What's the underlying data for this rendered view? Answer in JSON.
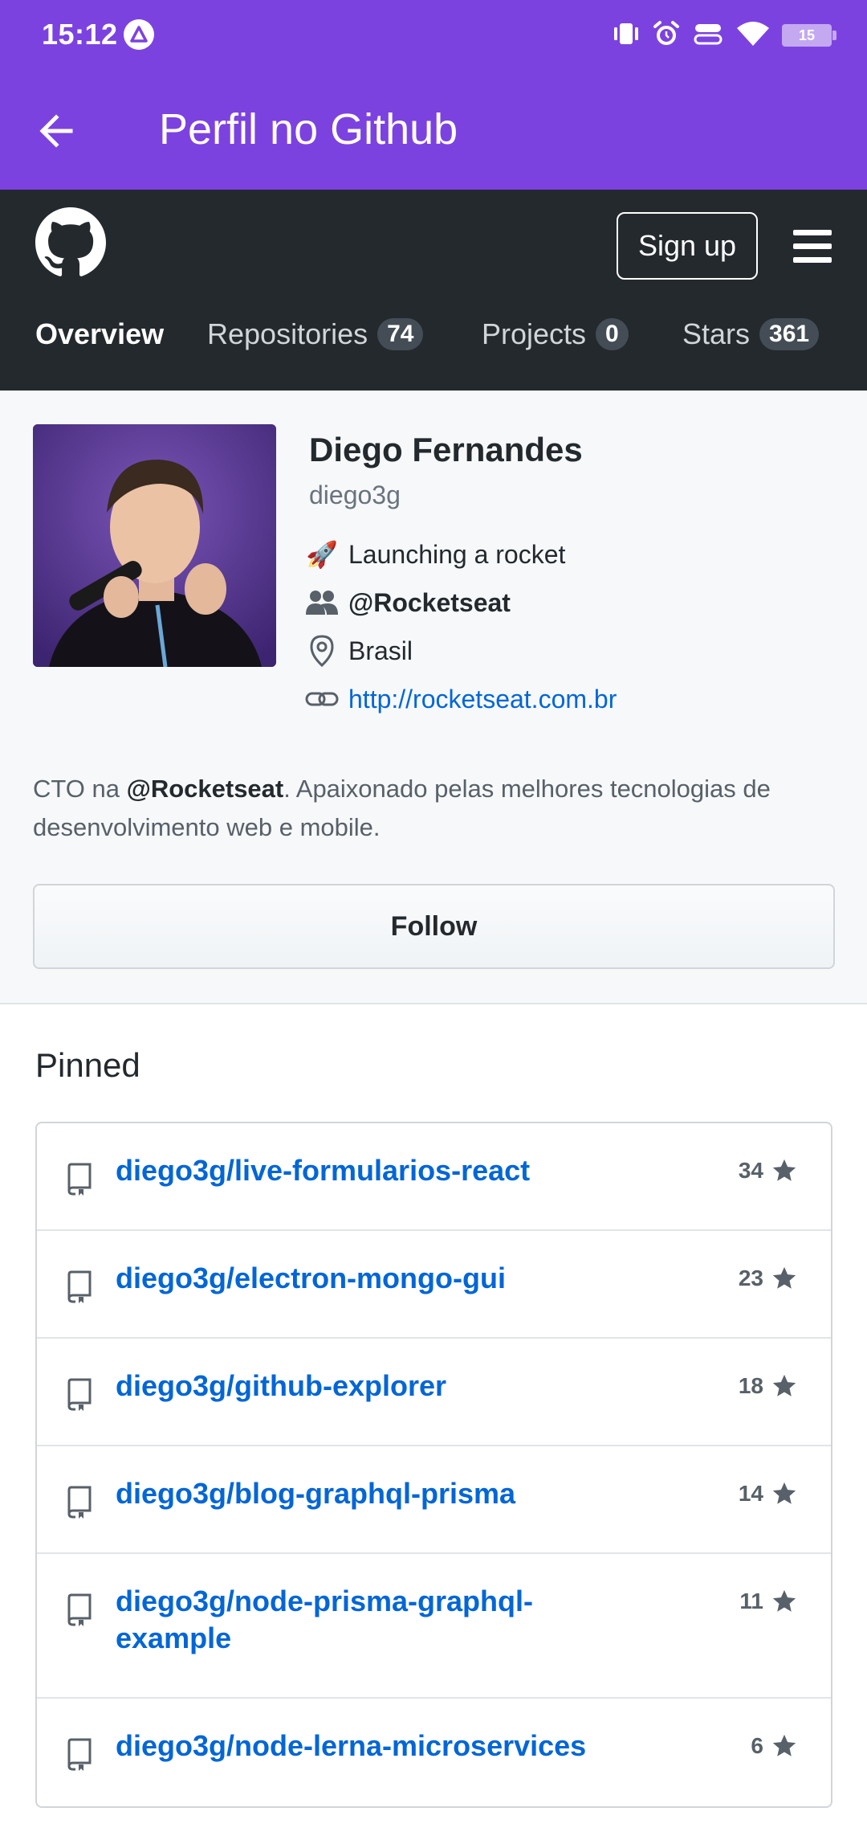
{
  "status_bar": {
    "time": "15:12",
    "battery": "15"
  },
  "app_bar": {
    "title": "Perfil no Github"
  },
  "github_header": {
    "signup_label": "Sign up",
    "tabs": [
      {
        "label": "Overview",
        "count": null
      },
      {
        "label": "Repositories",
        "count": "74"
      },
      {
        "label": "Projects",
        "count": "0"
      },
      {
        "label": "Stars",
        "count": "361"
      }
    ]
  },
  "profile": {
    "name": "Diego Fernandes",
    "login": "diego3g",
    "status": "Launching a rocket",
    "status_emoji": "🚀",
    "organization": "@Rocketseat",
    "location": "Brasil",
    "website": "http://rocketseat.com.br",
    "bio_prefix": "CTO na ",
    "bio_mention": "@Rocketseat",
    "bio_line1_rest": ". Apaixonado pelas melhores tecnologias de",
    "bio_line2": "desenvolvimento web e mobile.",
    "follow_label": "Follow"
  },
  "pinned": {
    "title": "Pinned",
    "repos": [
      {
        "name": "diego3g/live-formularios-react",
        "stars": "34"
      },
      {
        "name": "diego3g/electron-mongo-gui",
        "stars": "23"
      },
      {
        "name": "diego3g/github-explorer",
        "stars": "18"
      },
      {
        "name": "diego3g/blog-graphql-prisma",
        "stars": "14"
      },
      {
        "name_line1": "diego3g/node-prisma-graphql-",
        "name_line2": "example",
        "stars": "11"
      },
      {
        "name": "diego3g/node-lerna-microservices",
        "stars": "6"
      }
    ]
  },
  "colors": {
    "app_bar": "#7c42e0",
    "github_header": "#24292e",
    "link": "#0366d6"
  }
}
